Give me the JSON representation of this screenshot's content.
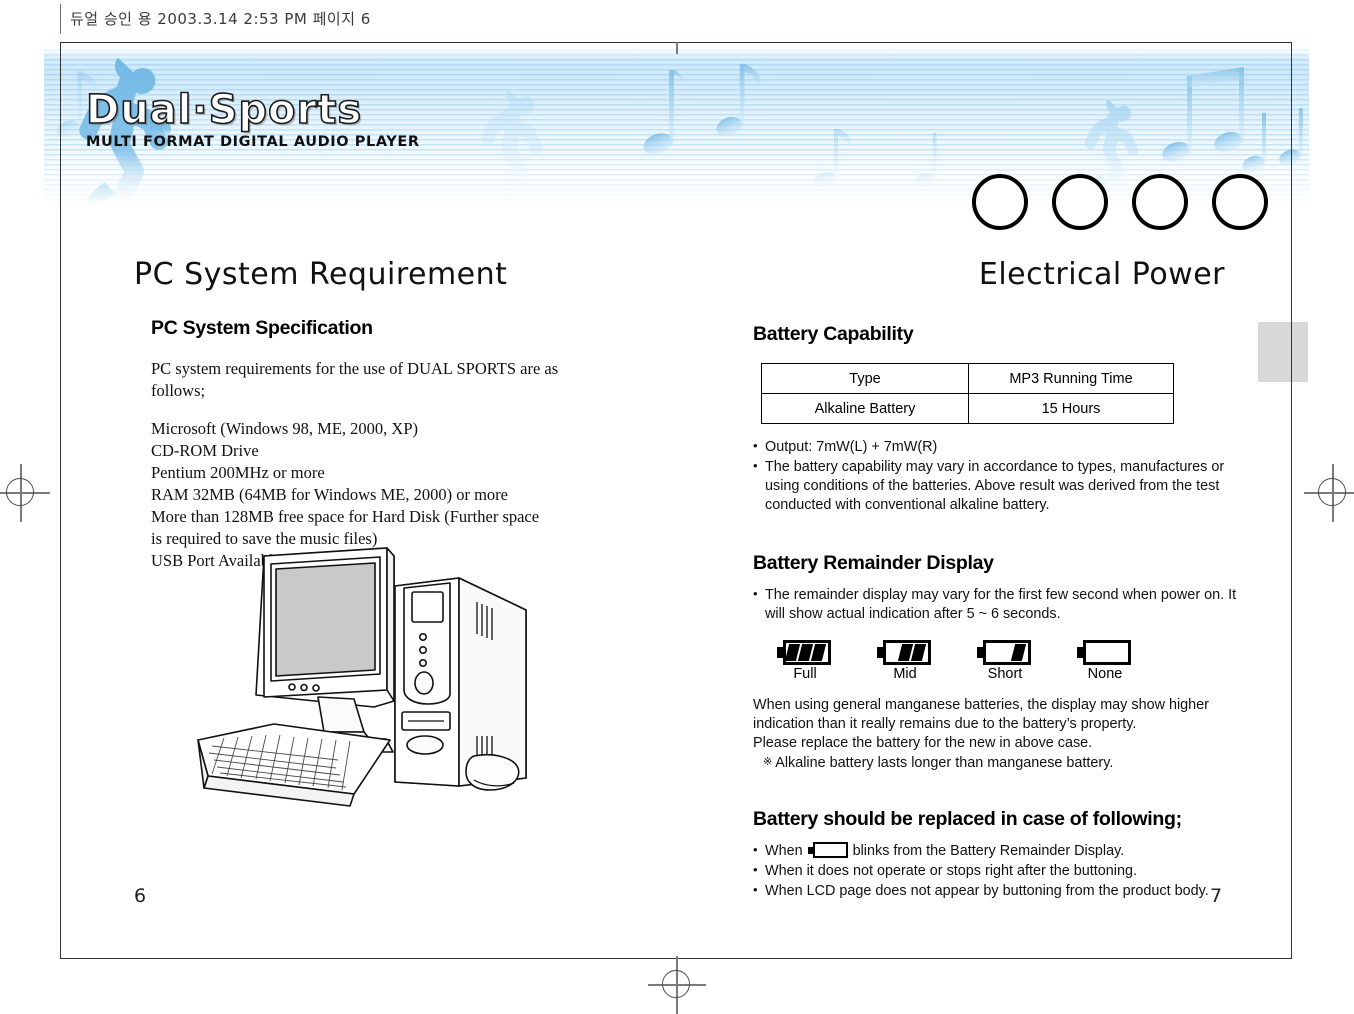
{
  "proof_header": {
    "text": "듀얼 승인 용  2003.3.14 2:53 PM 페이지 6"
  },
  "banner": {
    "logo_main": "Dual·Sports",
    "logo_sub": "MULTI FORMAT DIGITAL AUDIO PLAYER",
    "circle_count": 4
  },
  "left_page": {
    "page_number": "6",
    "section_title": "PC System Requirement",
    "sub_title": "PC System Specification",
    "intro": "PC system requirements for the use of DUAL SPORTS are as follows;",
    "requirements": [
      "Microsoft (Windows 98, ME, 2000, XP)",
      "CD-ROM Drive",
      "Pentium 200MHz or more",
      "RAM 32MB (64MB for Windows ME, 2000) or more",
      "More than 128MB free space for Hard Disk (Further space",
      "is required to save the music files)",
      "USB Port Available"
    ],
    "illustration_name": "desktop-pc-illustration"
  },
  "right_page": {
    "page_number": "7",
    "section_title": "Electrical Power",
    "battery_capability": {
      "heading": "Battery Capability",
      "table": {
        "headers": [
          "Type",
          "MP3 Running Time"
        ],
        "rows": [
          [
            "Alkaline Battery",
            "15 Hours"
          ]
        ]
      },
      "bullets": [
        "Output: 7mW(L) + 7mW(R)",
        "The battery capability may vary in accordance to types, manufactures or using conditions of the batteries. Above result was derived from the test conducted with conventional alkaline battery."
      ]
    },
    "battery_remainder": {
      "heading": "Battery Remainder Display",
      "bullets": [
        "The remainder display may vary for the first few second when power on. It will show actual indication after 5 ~ 6 seconds."
      ],
      "icons": [
        {
          "label": "Full",
          "bars": 3
        },
        {
          "label": "Mid",
          "bars": 2
        },
        {
          "label": "Short",
          "bars": 1
        },
        {
          "label": "None",
          "bars": 0
        }
      ],
      "paragraph_lines": [
        "When using general manganese batteries, the display may show higher",
        "indication than it really remains due to the battery’s property.",
        "Please replace the battery for the new in above case."
      ],
      "note_mark": "※",
      "note_text": "Alkaline battery lasts longer than manganese battery."
    },
    "battery_replace": {
      "heading": "Battery should be replaced in case of following;",
      "bullet_1_prefix": "When",
      "bullet_1_suffix": "blinks from the Battery Remainder Display.",
      "bullets": [
        "When it does not operate or stops right after the buttoning.",
        "When LCD page does not appear by buttoning from the product body."
      ]
    }
  },
  "colors": {
    "banner_blue": "#7ab9e6",
    "thumb_tab_gray": "#d8d8d8",
    "ink_black": "#111111"
  }
}
